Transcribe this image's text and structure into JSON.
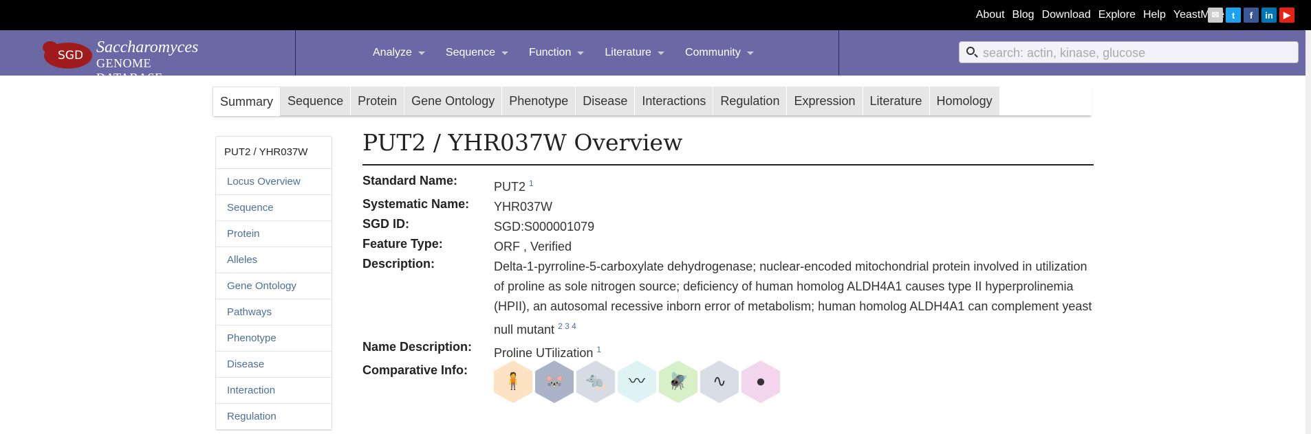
{
  "top_links": [
    "About",
    "Blog",
    "Download",
    "Explore",
    "Help",
    "YeastMine"
  ],
  "social": [
    {
      "name": "mail-icon",
      "glyph": "✉",
      "color": "#cccccc"
    },
    {
      "name": "twitter-icon",
      "glyph": "t",
      "color": "#1da1f2"
    },
    {
      "name": "facebook-icon",
      "glyph": "f",
      "color": "#3b5998"
    },
    {
      "name": "linkedin-icon",
      "glyph": "in",
      "color": "#0077b5"
    },
    {
      "name": "youtube-icon",
      "glyph": "▶",
      "color": "#e62117"
    }
  ],
  "logo": {
    "badge": "SGD",
    "line1": "Saccharomyces",
    "line2": "GENOME DATABASE"
  },
  "menu": [
    "Analyze",
    "Sequence",
    "Function",
    "Literature",
    "Community"
  ],
  "search": {
    "placeholder": "search: actin, kinase, glucose"
  },
  "tabs": [
    "Summary",
    "Sequence",
    "Protein",
    "Gene Ontology",
    "Phenotype",
    "Disease",
    "Interactions",
    "Regulation",
    "Expression",
    "Literature",
    "Homology"
  ],
  "active_tab": "Summary",
  "sidebar": {
    "header": "PUT2 / YHR037W",
    "items": [
      "Locus Overview",
      "Sequence",
      "Protein",
      "Alleles",
      "Gene Ontology",
      "Pathways",
      "Phenotype",
      "Disease",
      "Interaction",
      "Regulation"
    ]
  },
  "overview": {
    "title": "PUT2 / YHR037W Overview",
    "standard_name_label": "Standard Name:",
    "standard_name": "PUT2",
    "standard_name_ref": "1",
    "systematic_name_label": "Systematic Name:",
    "systematic_name": "YHR037W",
    "sgd_id_label": "SGD ID:",
    "sgd_id": "SGD:S000001079",
    "feature_type_label": "Feature Type:",
    "feature_type": "ORF , Verified",
    "description_label": "Description:",
    "description": "Delta-1-pyrroline-5-carboxylate dehydrogenase; nuclear-encoded mitochondrial protein involved in utilization of proline as sole nitrogen source; deficiency of human homolog ALDH4A1 causes type II hyperprolinemia (HPII), an autosomal recessive inborn error of metabolism; human homolog ALDH4A1 can complement yeast null mutant",
    "description_refs": "2 3 4",
    "name_description_label": "Name Description:",
    "name_description": "Proline UTilization",
    "name_description_ref": "1",
    "comparative_label": "Comparative Info:"
  },
  "comparative_icons": [
    {
      "name": "human-icon",
      "glyph": "🧍",
      "color": "#fde2c4"
    },
    {
      "name": "mouse-icon",
      "glyph": "🐭",
      "color": "#aab3c8"
    },
    {
      "name": "rat-icon",
      "glyph": "🐀",
      "color": "#d7dce4"
    },
    {
      "name": "zebrafish-icon",
      "glyph": "〰",
      "color": "#dff3f5"
    },
    {
      "name": "fly-icon",
      "glyph": "🪰",
      "color": "#d8f0c8"
    },
    {
      "name": "worm-icon",
      "glyph": "∿",
      "color": "#d8dde6"
    },
    {
      "name": "yeast-icon",
      "glyph": "●",
      "color": "#f3d6ee"
    }
  ]
}
